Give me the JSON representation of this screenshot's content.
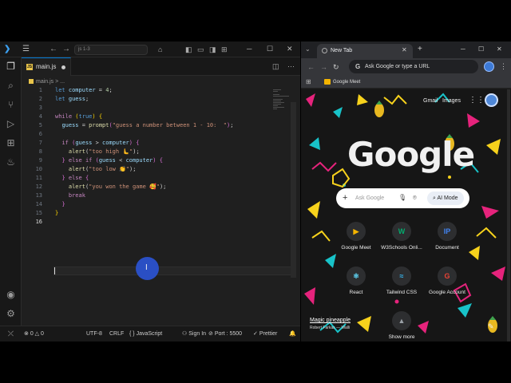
{
  "vscode": {
    "search_label": "js 1-3",
    "tab_label": "main.js",
    "tab_badge": "JS",
    "breadcrumb_file": "main.js",
    "breadcrumb_rest": "> ...",
    "line_numbers": [
      "1",
      "2",
      "3",
      "4",
      "5",
      "6",
      "7",
      "8",
      "9",
      "10",
      "11",
      "12",
      "13",
      "14",
      "15",
      "16"
    ],
    "status": {
      "errors": "0",
      "warnings": "0",
      "encoding": "UTF-8",
      "eol": "CRLF",
      "language": "{ } JavaScript",
      "signin": "Sign In",
      "port": "Port : 5500",
      "prettier": "Prettier"
    },
    "icons": [
      "vscode-logo-icon",
      "hamburger-menu-icon",
      "explorer-icon",
      "search-icon",
      "source-control-icon",
      "run-debug-icon",
      "extensions-icon",
      "python-icon",
      "account-icon",
      "settings-gear-icon"
    ]
  },
  "chrome": {
    "tab_title": "New Tab",
    "omnibox_placeholder": "Ask Google or type a URL",
    "bookmark": "Google Meet",
    "top_links": {
      "gmail": "Gmail",
      "images": "Images"
    },
    "logo": "Google",
    "search_placeholder": "Ask Google",
    "ai_mode": "AI Mode",
    "shortcuts": [
      {
        "label": "Google Meet",
        "glyph": "▶",
        "color": "#f4b400"
      },
      {
        "label": "W3Schools Onli...",
        "glyph": "W",
        "color": "#04aa6d"
      },
      {
        "label": "Document",
        "glyph": "IP",
        "color": "#4285f4"
      },
      {
        "label": "React",
        "glyph": "⚛",
        "color": "#61dafb"
      },
      {
        "label": "Tailwind CSS",
        "glyph": "≈",
        "color": "#38bdf8"
      },
      {
        "label": "Google Account",
        "glyph": "G",
        "color": "#ea4335"
      },
      {
        "label": "Show more",
        "glyph": "▲",
        "color": "#9aa0a6"
      }
    ],
    "credit": {
      "title": "Magic pineapple",
      "author": "Robert Farkas — Walli"
    }
  }
}
